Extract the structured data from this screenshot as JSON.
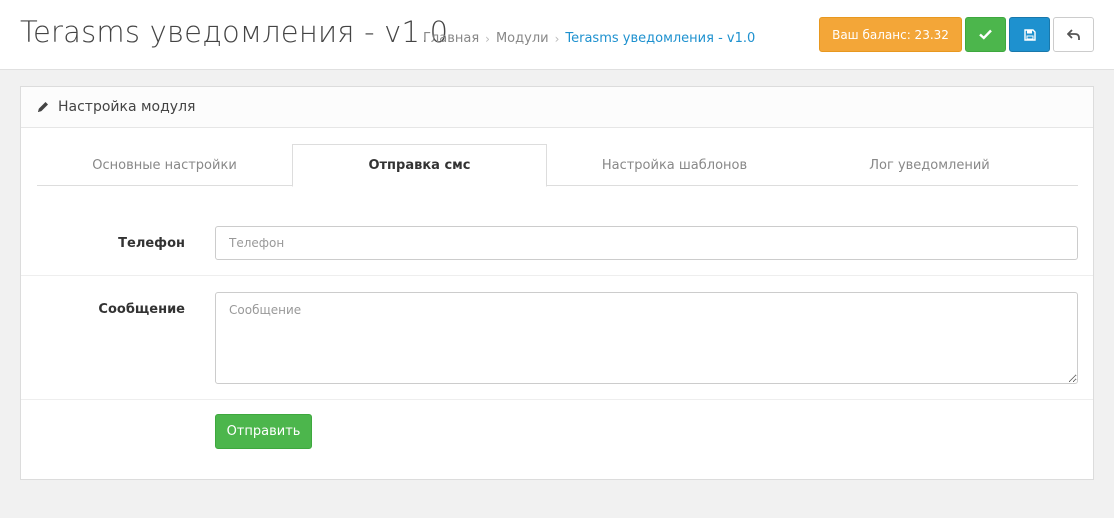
{
  "header": {
    "title": "Terasms уведомления - v1.0",
    "breadcrumb": [
      "Главная",
      "Модули",
      "Terasms уведомления - v1.0"
    ],
    "balance_label": "Ваш баланс: 23.32",
    "icons": {
      "save_stay": "check-icon",
      "save": "floppy-disk-icon",
      "back": "reply-arrow-icon"
    }
  },
  "panel": {
    "title": "Настройка модуля",
    "tabs": [
      {
        "label": "Основные настройки",
        "active": false
      },
      {
        "label": "Отправка смс",
        "active": true
      },
      {
        "label": "Настройка шаблонов",
        "active": false
      },
      {
        "label": "Лог уведомлений",
        "active": false
      }
    ],
    "form": {
      "phone": {
        "label": "Телефон",
        "placeholder": "Телефон",
        "value": ""
      },
      "message": {
        "label": "Сообщение",
        "placeholder": "Сообщение",
        "value": ""
      },
      "submit_label": "Отправить"
    }
  },
  "colors": {
    "balance": "#f3a638",
    "success": "#4cb64c",
    "primary": "#1e91cf",
    "link": "#1e91cf"
  }
}
